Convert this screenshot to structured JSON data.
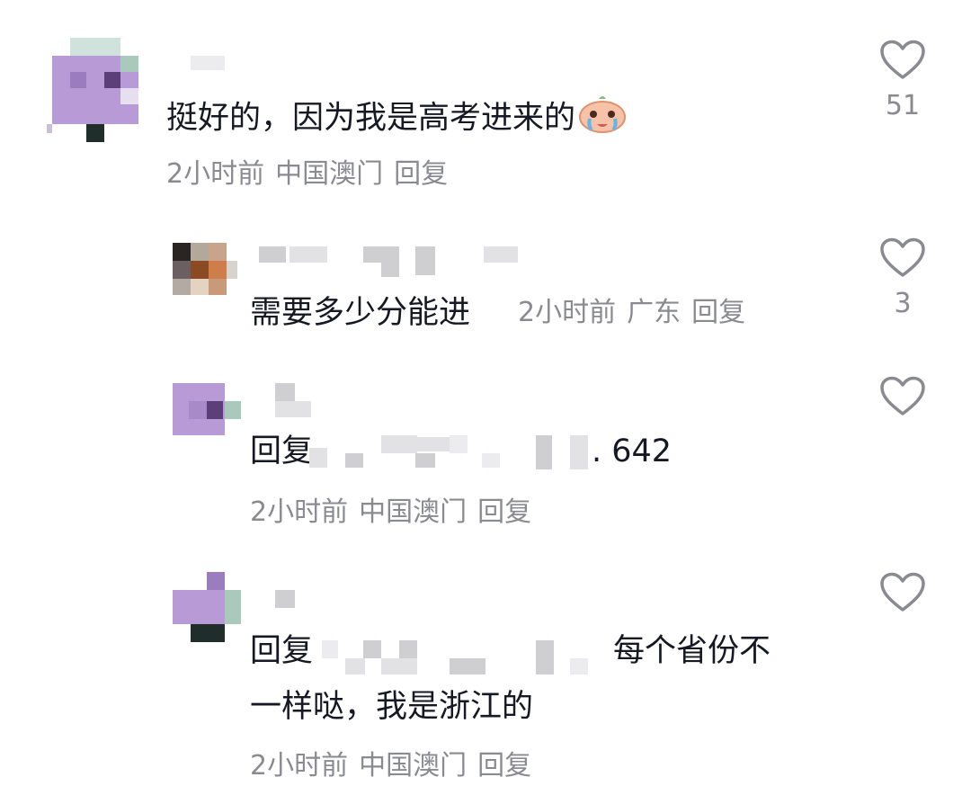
{
  "comments": [
    {
      "text": "挺好的，因为我是高考进来的",
      "emoji": "crying-face-emoji",
      "time": "2小时前",
      "location": "中国澳门",
      "reply_label": "回复",
      "likes": "51"
    },
    {
      "text": "需要多少分能进",
      "time": "2小时前",
      "location": "广东",
      "reply_label": "回复",
      "likes": "3"
    },
    {
      "prefix": "回复",
      "text_visible": ". 642",
      "time": "2小时前",
      "location": "中国澳门",
      "reply_label": "回复"
    },
    {
      "prefix": "回复",
      "text_line1": "每个省份不",
      "text_line2": "一样哒，我是浙江的",
      "time": "2小时前",
      "location": "中国澳门",
      "reply_label": "回复"
    }
  ],
  "icons": {
    "like": "heart-outline-icon"
  },
  "colors": {
    "text": "#161823",
    "meta": "#8a8b91",
    "avatar_purple": "#b89ad6"
  }
}
